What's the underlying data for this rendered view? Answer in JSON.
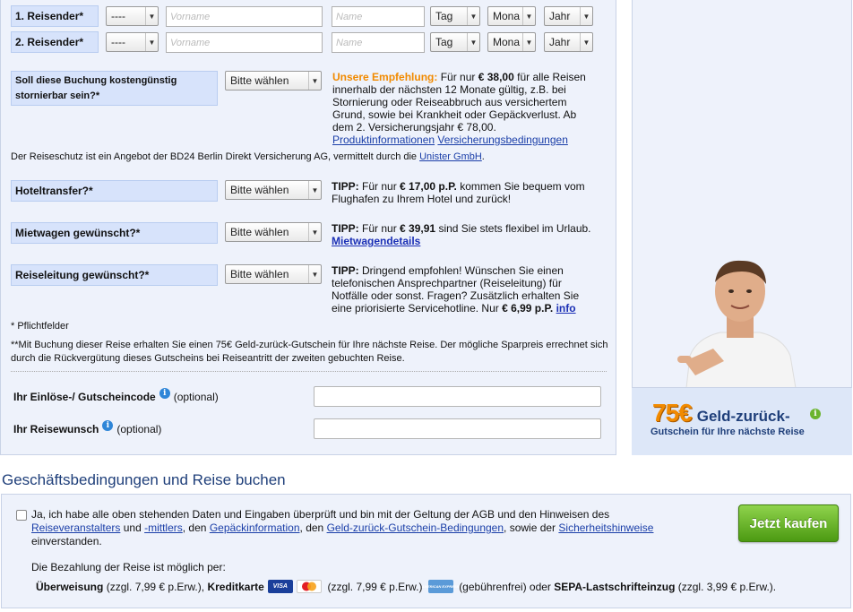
{
  "travelers": [
    {
      "label": "1. Reisender*",
      "salutation": "----",
      "firstname_placeholder": "Vorname",
      "lastname_placeholder": "Name",
      "day": "Tag",
      "month": "Mona",
      "year": "Jahr"
    },
    {
      "label": "2. Reisender*",
      "salutation": "----",
      "firstname_placeholder": "Vorname",
      "lastname_placeholder": "Name",
      "day": "Tag",
      "month": "Mona",
      "year": "Jahr"
    }
  ],
  "storno": {
    "label_line1": "Soll diese Buchung kostengünstig",
    "label_line2": "stornierbar sein?*",
    "select": "Bitte wählen",
    "reco_title": "Unsere Empfehlung:",
    "reco_text1": "Für nur",
    "reco_price": "€ 38,00",
    "reco_text2": "für alle Reisen",
    "line2": "innerhalb der nächsten 12 Monate gültig, z.B. bei",
    "line3": "Stornierung oder Reiseabbruch aus versichertem",
    "line4": "Grund, sowie bei Krankheit oder Gepäckverlust. Ab",
    "line5": "dem 2. Versicherungsjahr € 78,00.",
    "link1": "Produktinformationen",
    "link2": "Versicherungsbedingungen"
  },
  "insurance_note": {
    "text": "Der Reiseschutz ist ein Angebot der BD24 Berlin Direkt Versicherung AG, vermittelt durch die",
    "link": "Unister GmbH",
    "end": "."
  },
  "hotel": {
    "label": "Hoteltransfer?*",
    "select": "Bitte wählen",
    "tip": "TIPP:",
    "t1": "Für nur",
    "price": "€ 17,00 p.P.",
    "t2": "kommen Sie bequem vom",
    "line2": "Flughafen zu Ihrem Hotel und zurück!"
  },
  "car": {
    "label": "Mietwagen gewünscht?*",
    "select": "Bitte wählen",
    "tip": "TIPP:",
    "t1": "Für nur",
    "price": "€ 39,91",
    "t2": "sind Sie stets flexibel im Urlaub.",
    "link": "Mietwagendetails"
  },
  "guide": {
    "label": "Reiseleitung gewünscht?*",
    "select": "Bitte wählen",
    "tip": "TIPP:",
    "line1": "Dringend empfohlen! Wünschen Sie einen",
    "line2": "telefonischen Ansprechpartner (Reiseleitung) für",
    "line3": "Notfälle oder sonst. Fragen? Zusätzlich erhalten Sie",
    "line4a": "eine priorisierte Servicehotline. Nur",
    "price": "€ 6,99 p.P.",
    "link": "info"
  },
  "required_note": "* Pflichtfelder",
  "voucher_note_line1": "**Mit Buchung dieser Reise erhalten Sie einen 75€ Geld-zurück-Gutschein für Ihre nächste Reise. Der mögliche Sparpreis errechnet sich",
  "voucher_note_line2": "durch die Rückvergütung dieses Gutscheins bei Reiseantritt der zweiten gebuchten Reise.",
  "coupon": {
    "label": "Ihr Einlöse-/ Gutscheincode",
    "optional": "(optional)"
  },
  "wish": {
    "label": "Ihr Reisewunsch",
    "optional": "(optional)"
  },
  "promo": {
    "amount": "75€",
    "title": "Geld-zurück-",
    "subtitle": "Gutschein für Ihre nächste Reise"
  },
  "section_title": "Geschäftsbedingungen und Reise buchen",
  "agb": {
    "line1": "Ja, ich habe alle oben stehenden Daten und Eingaben überprüft und bin mit der Geltung der AGB und den Hinweisen des",
    "link1": "Reiseveranstalters",
    "and": "und",
    "link2": "-mittlers",
    "comma1": ", den",
    "link3": "Gepäckinformation",
    "comma2": ", den",
    "link4": "Geld-zurück-Gutschein-Bedingungen",
    "comma3": ", sowie der",
    "link5": "Sicherheitshinweise",
    "line3": "einverstanden."
  },
  "buy_button": "Jetzt kaufen",
  "payment": {
    "intro": "Die Bezahlung der Reise ist möglich per:",
    "transfer": "Überweisung",
    "transfer_fee": "(zzgl. 7,99 € p.Erw.),",
    "card": "Kreditkarte",
    "visa": "VISA",
    "mc": "MasterCard",
    "card_fee": "(zzgl. 7,99 € p.Erw.)",
    "amex": "AMERICAN EXPRESS",
    "amex_fee": "(gebührenfrei) oder",
    "sepa": "SEPA-Lastschrifteinzug",
    "sepa_fee": "(zzgl. 3,99 € p.Erw.)."
  },
  "colors": {
    "accent_blue": "#1f3f7a",
    "orange": "#f18a00",
    "green": "#5aab1e",
    "label_bg": "#d7e3fb",
    "panel_bg": "#eef2fb"
  }
}
